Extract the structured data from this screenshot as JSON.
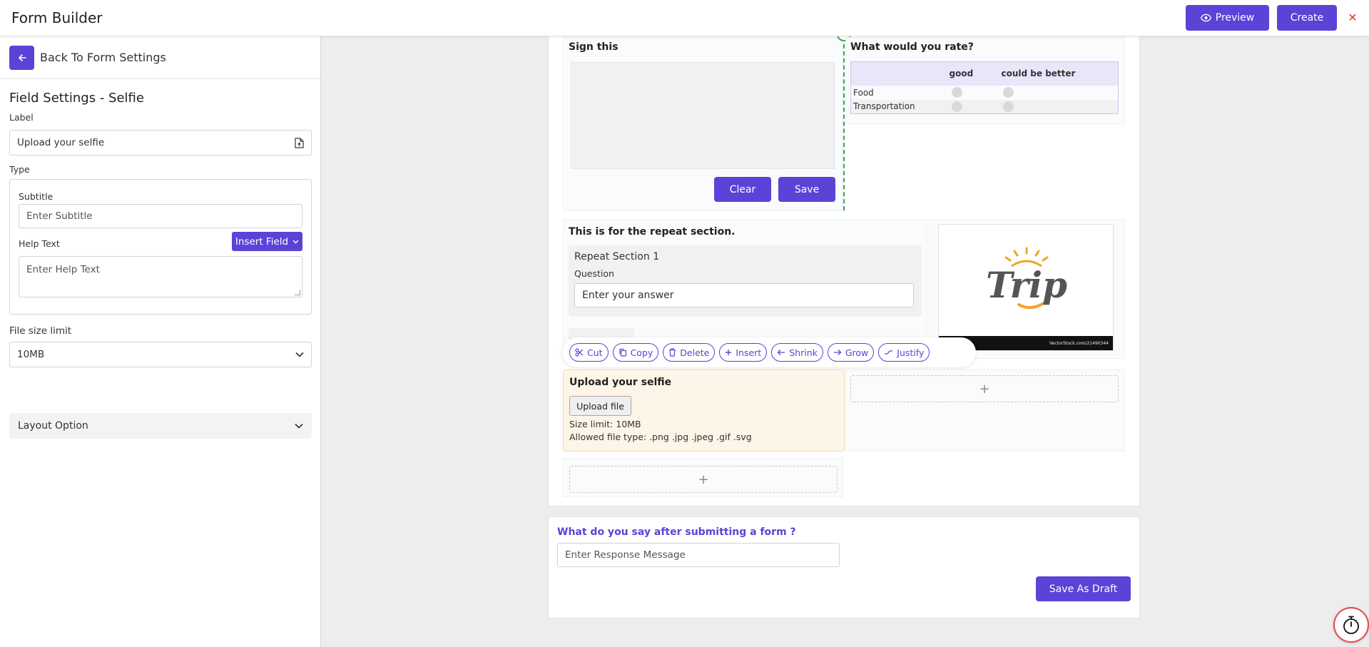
{
  "header": {
    "title": "Form Builder",
    "preview_label": "Preview",
    "create_label": "Create",
    "close_glyph": "✕"
  },
  "sidebar": {
    "back_label": "Back To Form Settings",
    "title": "Field Settings - Selfie",
    "label_caption": "Label",
    "label_value": "Upload your selfie",
    "type_caption": "Type",
    "subtitle_caption": "Subtitle",
    "subtitle_placeholder": "Enter Subtitle",
    "help_caption": "Help Text",
    "insert_field_label": "Insert Field",
    "help_placeholder": "Enter Help Text",
    "file_size_caption": "File size limit",
    "file_size_value": "10MB",
    "layout_option_label": "Layout Option"
  },
  "canvas": {
    "signature": {
      "title": "Sign this",
      "clear_label": "Clear",
      "save_label": "Save"
    },
    "rating": {
      "title": "What would you rate?",
      "columns": [
        "good",
        "could be better"
      ],
      "rows": [
        "Food",
        "Transportation"
      ]
    },
    "repeat": {
      "title": "This is for the repeat section.",
      "section_label": "Repeat Section 1",
      "question_label": "Question",
      "answer_placeholder": "Enter your answer"
    },
    "image": {
      "logo_text": "Trip",
      "caption": "VectorStock.com/21490344"
    },
    "toolbar": {
      "cut": "Cut",
      "copy": "Copy",
      "delete": "Delete",
      "insert": "Insert",
      "shrink": "Shrink",
      "grow": "Grow",
      "justify": "Justify"
    },
    "upload": {
      "title": "Upload your selfie",
      "button_label": "Upload file",
      "size_limit": "Size limit: 10MB",
      "allowed_types": "Allowed file type: .png .jpg .jpeg .gif .svg"
    },
    "add_glyph": "+"
  },
  "response": {
    "question": "What do you say after submitting a form ?",
    "placeholder": "Enter Response Message",
    "save_draft_label": "Save As Draft"
  },
  "colors": {
    "primary": "#5a43d6",
    "danger": "#e53935",
    "upload_highlight": "#fdf5e8",
    "divider_guide": "#33a853"
  }
}
